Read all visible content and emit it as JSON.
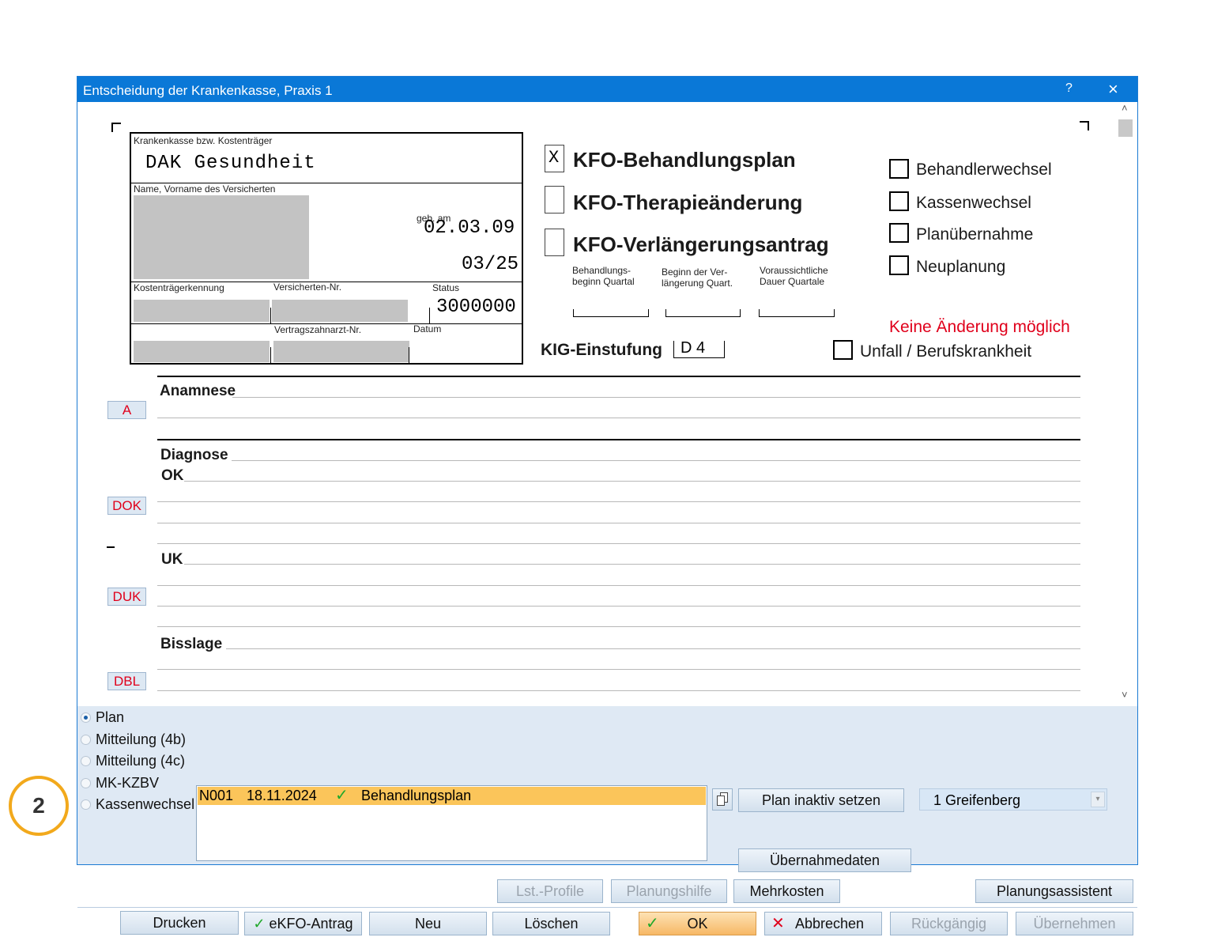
{
  "window": {
    "title": "Entscheidung der Krankenkasse, Praxis 1",
    "help_label": "?",
    "close_label": "×"
  },
  "insurance_card": {
    "kasse_label": "Krankenkasse bzw. Kostenträger",
    "kasse_value": "DAK Gesundheit",
    "name_label": "Name, Vorname des Versicherten",
    "geb_label": "geb. am",
    "geb_value": "02.03.09",
    "valid_value": "03/25",
    "kostentraeger_label": "Kostenträgerkennung",
    "versicherten_label": "Versicherten-Nr.",
    "status_label": "Status",
    "status_value": "3000000",
    "vertragszahnarzt_label": "Vertragszahnarzt-Nr.",
    "datum_label": "Datum"
  },
  "plan_types": [
    {
      "label": "KFO-Behandlungsplan",
      "checked": true,
      "mark": "X"
    },
    {
      "label": "KFO-Therapieänderung",
      "checked": false,
      "mark": ""
    },
    {
      "label": "KFO-Verlängerungsantrag",
      "checked": false,
      "mark": ""
    }
  ],
  "quarters": {
    "col1": "Behandlungs-\nbeginn Quartal",
    "col2": "Beginn der Ver-\nlängerung Quart.",
    "col3": "Voraussichtliche\nDauer Quartale"
  },
  "kig": {
    "label": "KIG-Einstufung",
    "value": "D 4"
  },
  "right_options": [
    {
      "label": "Behandlerwechsel",
      "checked": false
    },
    {
      "label": "Kassenwechsel",
      "checked": false
    },
    {
      "label": "Planübernahme",
      "checked": false
    },
    {
      "label": "Neuplanung",
      "checked": false
    }
  ],
  "warning": "Keine Änderung möglich",
  "unfall": {
    "label": "Unfall / Berufskrankheit",
    "checked": false
  },
  "sections": {
    "anamnese": "Anamnese",
    "diagnose": "Diagnose",
    "ok": "OK",
    "uk": "UK",
    "bisslage": "Bisslage",
    "btn_a": "A",
    "btn_dok": "DOK",
    "btn_duk": "DUK",
    "btn_dbl": "DBL"
  },
  "radios": [
    {
      "label": "Plan",
      "selected": true
    },
    {
      "label": "Mitteilung (4b)",
      "selected": false
    },
    {
      "label": "Mitteilung (4c)",
      "selected": false
    },
    {
      "label": "MK-KZBV",
      "selected": false
    },
    {
      "label": "Kassenwechsel",
      "selected": false
    }
  ],
  "plan_list": [
    {
      "code": "N001",
      "date": "18.11.2024",
      "status_icon": "check-icon",
      "name": "Behandlungsplan"
    }
  ],
  "buttons": {
    "plan_inaktiv": "Plan inaktiv setzen",
    "uebernahmedaten": "Übernahmedaten",
    "lst_profile": "Lst.-Profile",
    "planungshilfe": "Planungshilfe",
    "mehrkosten": "Mehrkosten",
    "planungsassistent": "Planungsassistent",
    "drucken": "Drucken",
    "ekfo": "eKFO-Antrag",
    "neu": "Neu",
    "loeschen": "Löschen",
    "ok": "OK",
    "abbrechen": "Abbrechen",
    "rueckgaengig": "Rückgängig",
    "uebernehmen": "Übernehmen"
  },
  "location_combo": {
    "value": "1 Greifenberg"
  },
  "annotation_badge": "2",
  "colors": {
    "titlebar": "#0a78d7",
    "warning": "#e0001b",
    "plan_row": "#fbc55a",
    "badge_ring": "#f2a91c",
    "check": "#1fa82a"
  }
}
